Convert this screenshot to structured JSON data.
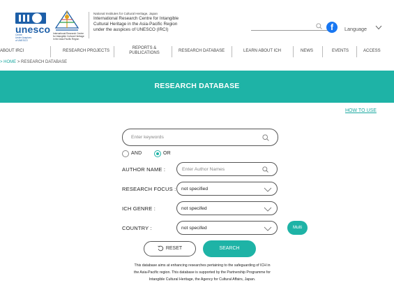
{
  "header": {
    "unesco_word": "unesco",
    "unesco_sub": [
      "Centre",
      "Under Auspices",
      "of UNESCO"
    ],
    "irci_sub": [
      "International Research Centre",
      "for Intangible Cultural Heritage",
      "in the Asia-Pacific Region"
    ],
    "small_line": "National Institutes for Cultural Heritage, Japan",
    "title_lines": [
      "International Research Centre for Intangible",
      "Cultural Heritage in the Asia-Pacific Region",
      "under the auspices of UNESCO (IRCI)"
    ],
    "language_label": "Language",
    "icons": [
      "search-icon",
      "facebook-icon",
      "chevron-down-icon"
    ],
    "colors": {
      "accent": "#1eb3a6",
      "unesco_blue": "#1d5fa8",
      "facebook": "#1877f2"
    }
  },
  "nav": {
    "items": [
      "ABOUT IRCI",
      "RESEARCH PROJECTS",
      "REPORTS &",
      "PUBLICATIONS",
      "RESEARCH DATABASE",
      "LEARN ABOUT ICH",
      "NEWS",
      "EVENTS",
      "ACCESS"
    ]
  },
  "breadcrumb": {
    "prefix": "> ",
    "home": "HOME",
    "sep": " > ",
    "current": "RESEARCH DATABASE"
  },
  "banner": {
    "title": "RESEARCH DATABASE"
  },
  "how_to_use": "HOW TO USE",
  "form": {
    "keywords_placeholder": "Enter keywords",
    "and_label": "AND",
    "or_label": "OR",
    "selected_logic": "OR",
    "author_label": "AUTHOR NAME :",
    "author_placeholder": "Enter Author Names",
    "focus_label": "RESEARCH FOCUS :",
    "focus_value": "not specified",
    "genre_label": "ICH GENRE :",
    "genre_value": "not specifed",
    "country_label": "COUNTRY :",
    "country_value": "not specifed",
    "multi_label": "Multi",
    "reset_label": "RESET",
    "search_label": "SEARCH"
  },
  "description": "This database aims at enhancing researches pertaining to the safeguarding of ICH in the Asia-Pacific region. This database is supported by the Partnership Programme for Intangible Cultural Heritage, the Agency for Cultural Affairs, Japan."
}
